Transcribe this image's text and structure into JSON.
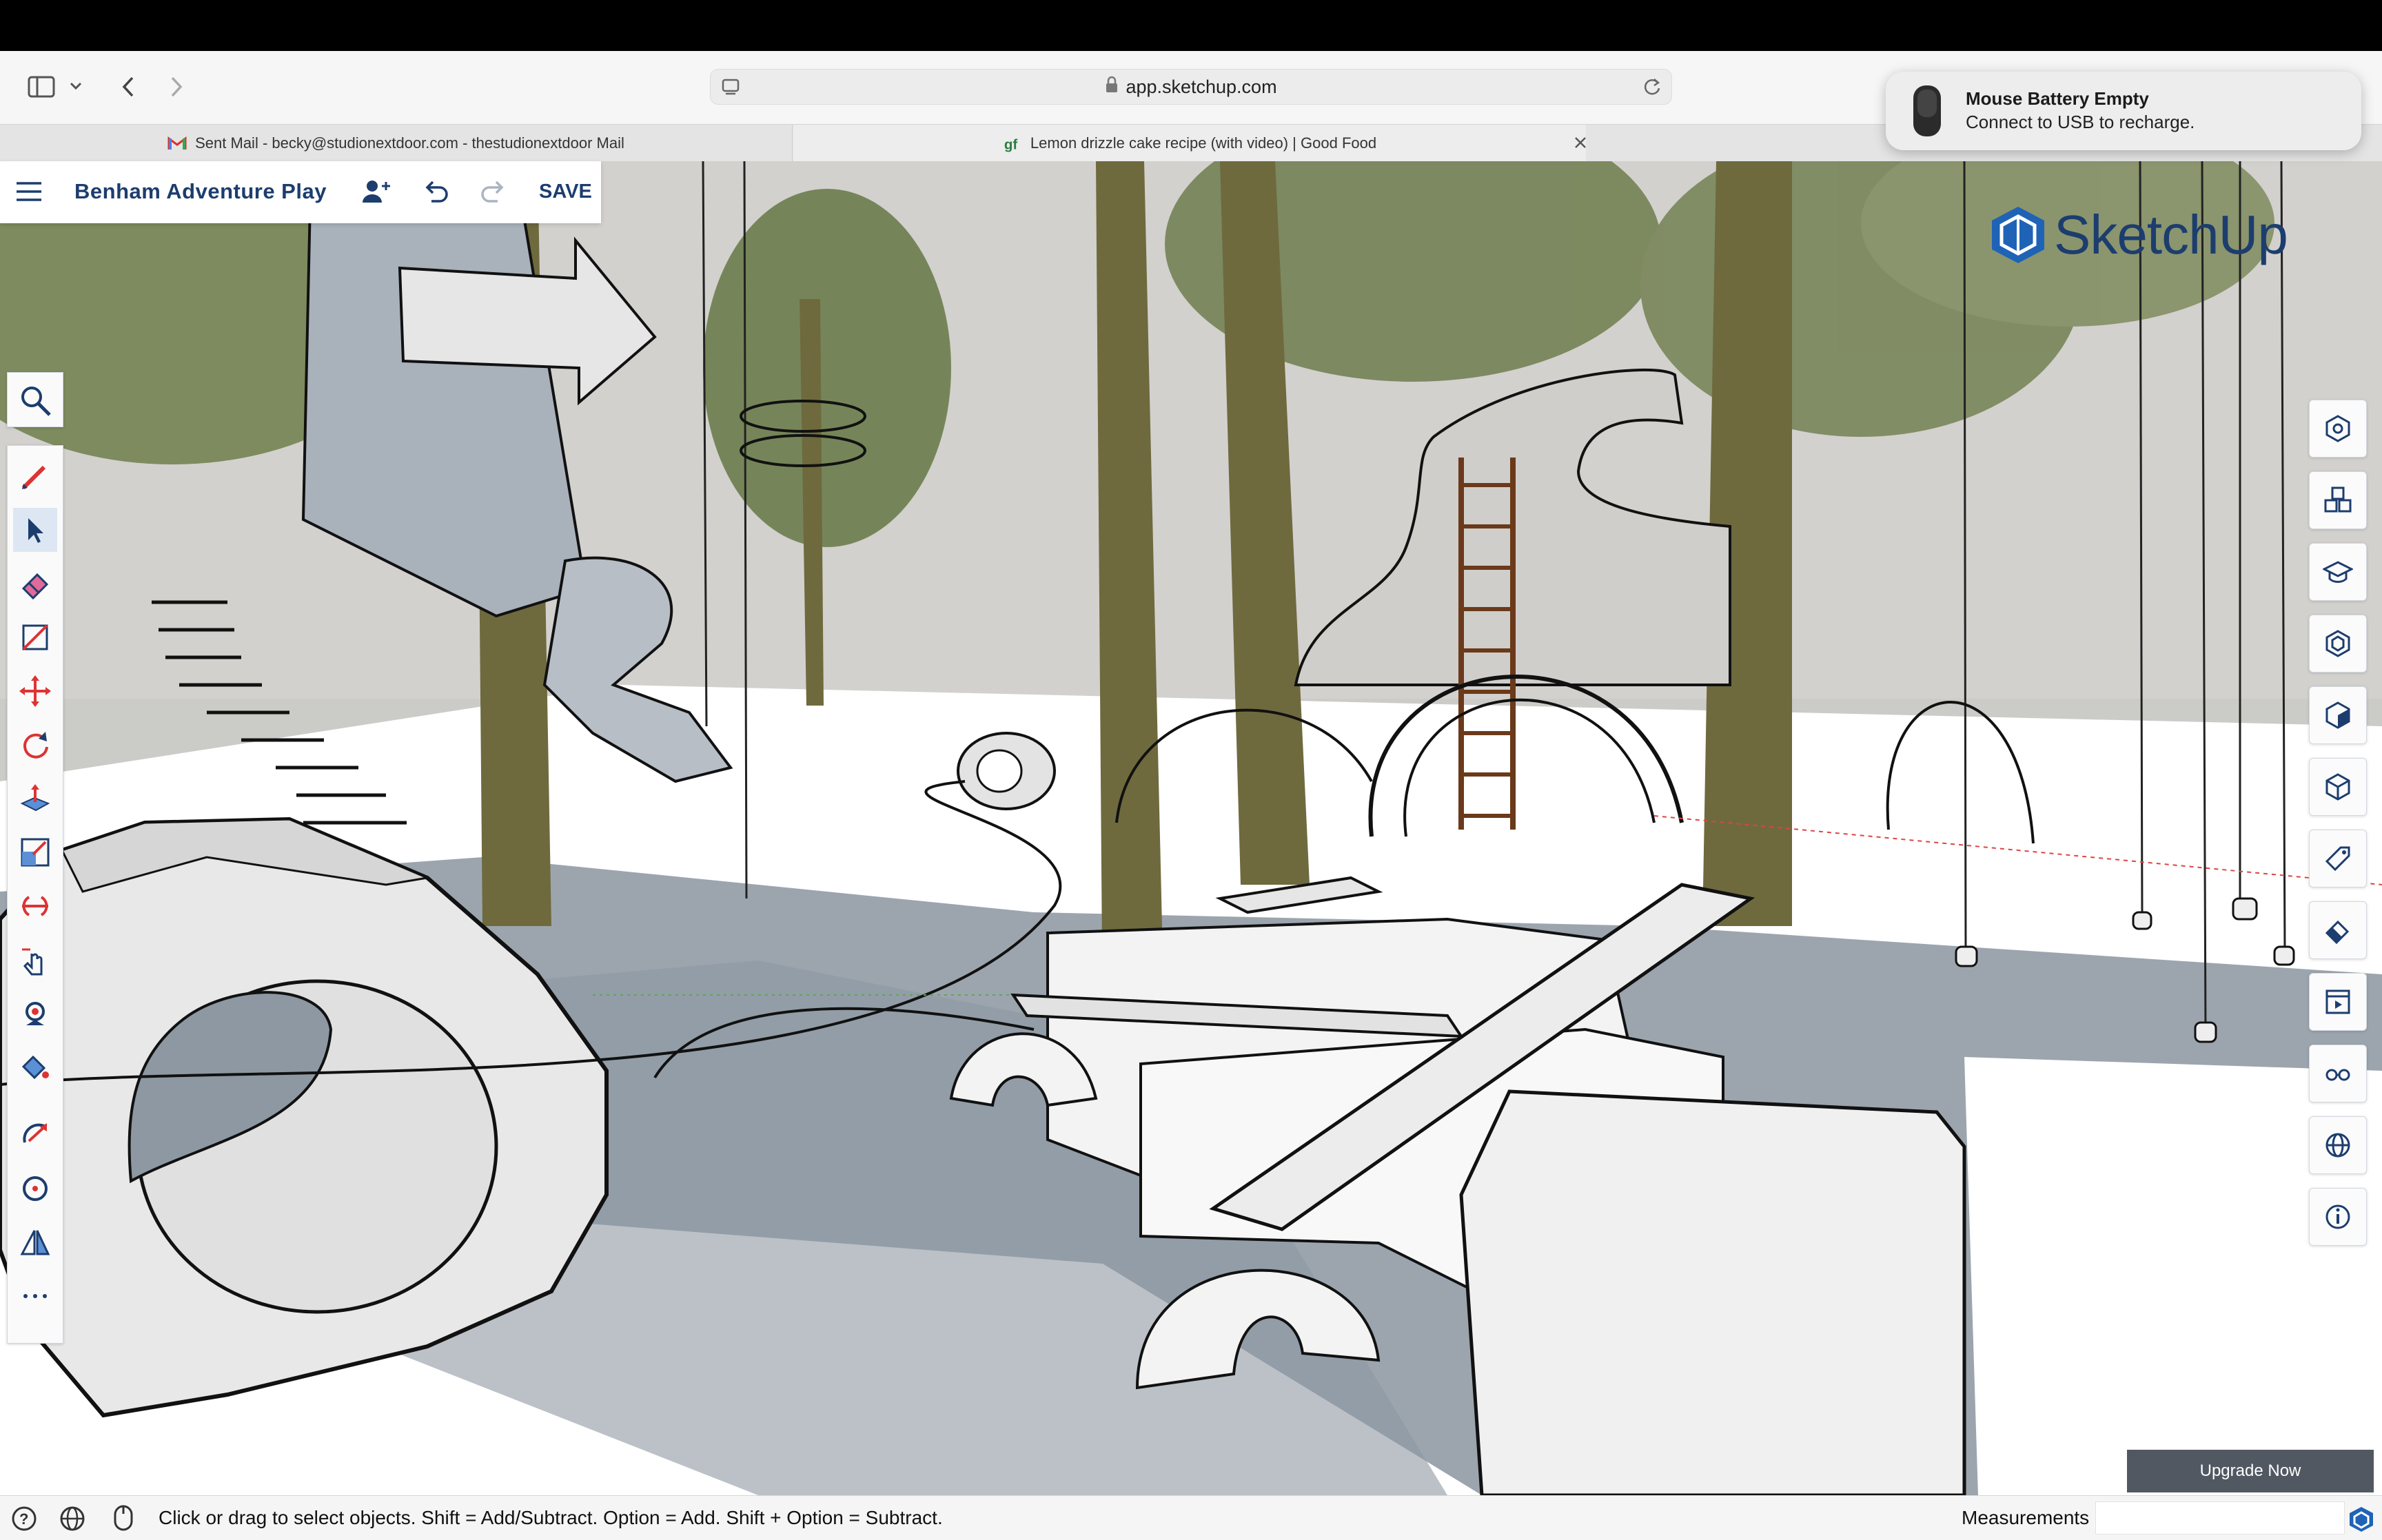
{
  "browser": {
    "url": "app.sketchup.com",
    "tabs": [
      {
        "label": "Sent Mail - becky@studionextdoor.com - thestudionextdoor Mail",
        "icon": "gmail-icon"
      },
      {
        "label": "Lemon drizzle cake recipe (with video) | Good Food",
        "icon": "goodfood-icon"
      }
    ]
  },
  "notification": {
    "title": "Mouse Battery Empty",
    "body": "Connect to USB to recharge."
  },
  "app": {
    "project_title": "Benham Adventure Play",
    "save_label": "SAVE",
    "logo_text": "SketchUp",
    "upgrade_label": "Upgrade Now"
  },
  "left_tools": [
    "search-tool",
    "pencil-tool",
    "select-tool",
    "eraser-tool",
    "tape-measure-tool",
    "move-tool",
    "rotate-tool",
    "push-pull-tool",
    "scale-tool",
    "offset-tool",
    "interact-tool",
    "paint-bucket-tool",
    "follow-me-tool",
    "orbit-tool",
    "orbit-target-tool",
    "section-plane-tool",
    "more-tools"
  ],
  "right_panel": [
    "entity-info-icon",
    "components-icon",
    "instructor-icon",
    "outliner-icon",
    "materials-icon",
    "styles-icon",
    "tags-icon",
    "eraser-styles-icon",
    "scenes-icon",
    "view-icon",
    "geo-location-icon",
    "info-icon"
  ],
  "status": {
    "message": "Click or drag to select objects. Shift = Add/Subtract. Option = Add. Shift + Option = Subtract.",
    "measurements_label": "Measurements",
    "measurements_value": ""
  }
}
